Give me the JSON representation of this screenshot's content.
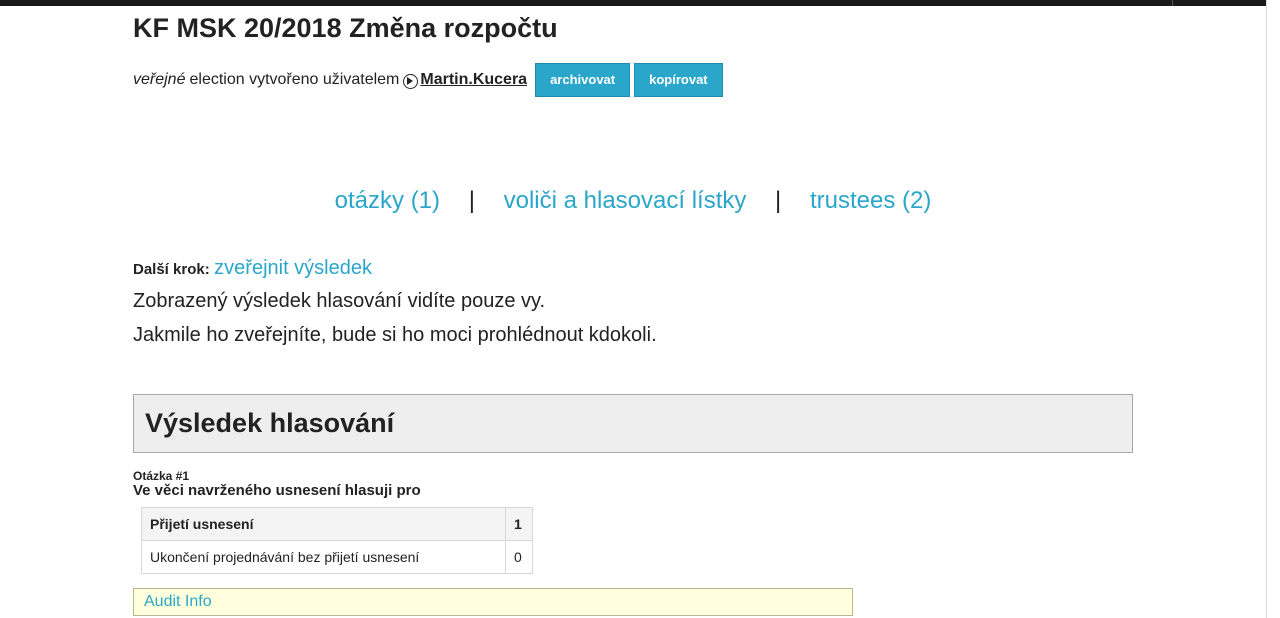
{
  "election": {
    "title": "KF MSK 20/2018 Změna rozpočtu",
    "visibility": "veřejné",
    "created_by_text": "election vytvořeno uživatelem",
    "username": "Martin.Kucera",
    "buttons": {
      "archive": "archivovat",
      "copy": "kopírovat"
    }
  },
  "nav": {
    "questions": "otázky (1)",
    "separator": "|",
    "voters": "voliči a hlasovací lístky",
    "trustees": "trustees (2)"
  },
  "next_step": {
    "label": "Další krok:",
    "link": "zveřejnit výsledek",
    "info_line_1": "Zobrazený výsledek hlasování vidíte pouze vy.",
    "info_line_2": "Jakmile ho zveřejníte, bude si ho moci prohlédnout kdokoli."
  },
  "results": {
    "heading": "Výsledek hlasování",
    "question_label": "Otázka #1",
    "question_text": "Ve věci navrženého usnesení hlasuji pro",
    "answers": [
      {
        "label": "Přijetí usnesení",
        "count": "1"
      },
      {
        "label": "Ukončení projednávání bez přijetí usnesení",
        "count": "0"
      }
    ],
    "audit_link": "Audit Info"
  },
  "colors": {
    "accent": "#2ba6cb",
    "panel_bg": "#eeeeee",
    "audit_bg": "#ffffdd"
  }
}
